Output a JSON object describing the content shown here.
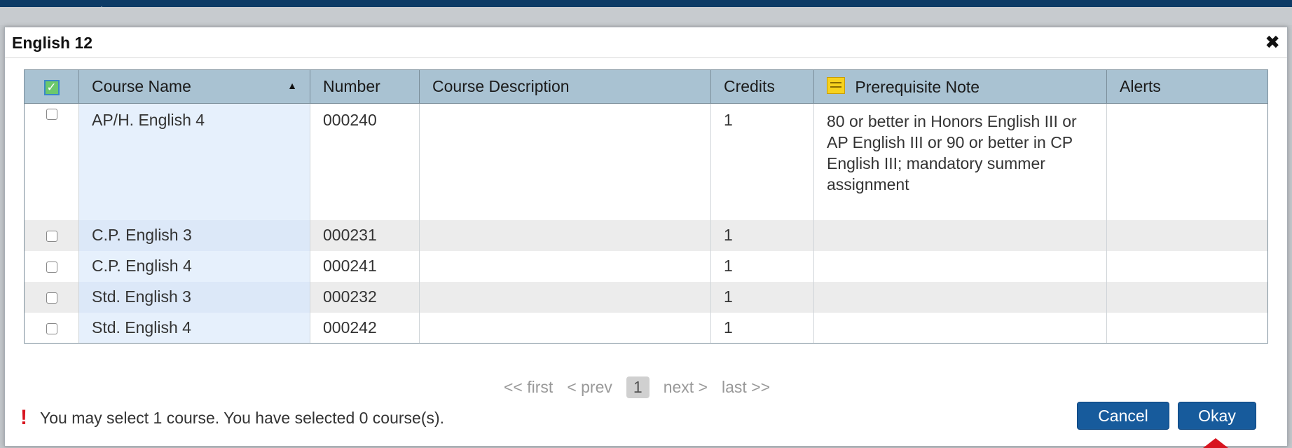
{
  "dialog": {
    "title": "English 12",
    "close_symbol": "✖"
  },
  "table": {
    "headers": {
      "course_name": "Course Name",
      "number": "Number",
      "description": "Course Description",
      "credits": "Credits",
      "prereq": "Prerequisite Note",
      "alerts": "Alerts"
    },
    "rows": [
      {
        "name": "AP/H. English 4",
        "number": "000240",
        "description": "",
        "credits": "1",
        "prereq": "80 or better in Honors English III or AP English III or 90 or better in CP English III; mandatory summer assignment",
        "alerts": ""
      },
      {
        "name": "C.P. English 3",
        "number": "000231",
        "description": "",
        "credits": "1",
        "prereq": "",
        "alerts": ""
      },
      {
        "name": "C.P. English 4",
        "number": "000241",
        "description": "",
        "credits": "1",
        "prereq": "",
        "alerts": ""
      },
      {
        "name": "Std. English 3",
        "number": "000232",
        "description": "",
        "credits": "1",
        "prereq": "",
        "alerts": ""
      },
      {
        "name": "Std. English 4",
        "number": "000242",
        "description": "",
        "credits": "1",
        "prereq": "",
        "alerts": ""
      }
    ]
  },
  "pager": {
    "first": "<< first",
    "prev": "< prev",
    "current": "1",
    "next": "next >",
    "last": "last >>"
  },
  "message": {
    "icon": "!",
    "text": "You may select 1 course.  You have selected 0 course(s)."
  },
  "buttons": {
    "cancel": "Cancel",
    "okay": "Okay"
  },
  "colors": {
    "header_bg": "#a9c2d2",
    "button_bg": "#175b9c",
    "warning": "#d8141f"
  }
}
